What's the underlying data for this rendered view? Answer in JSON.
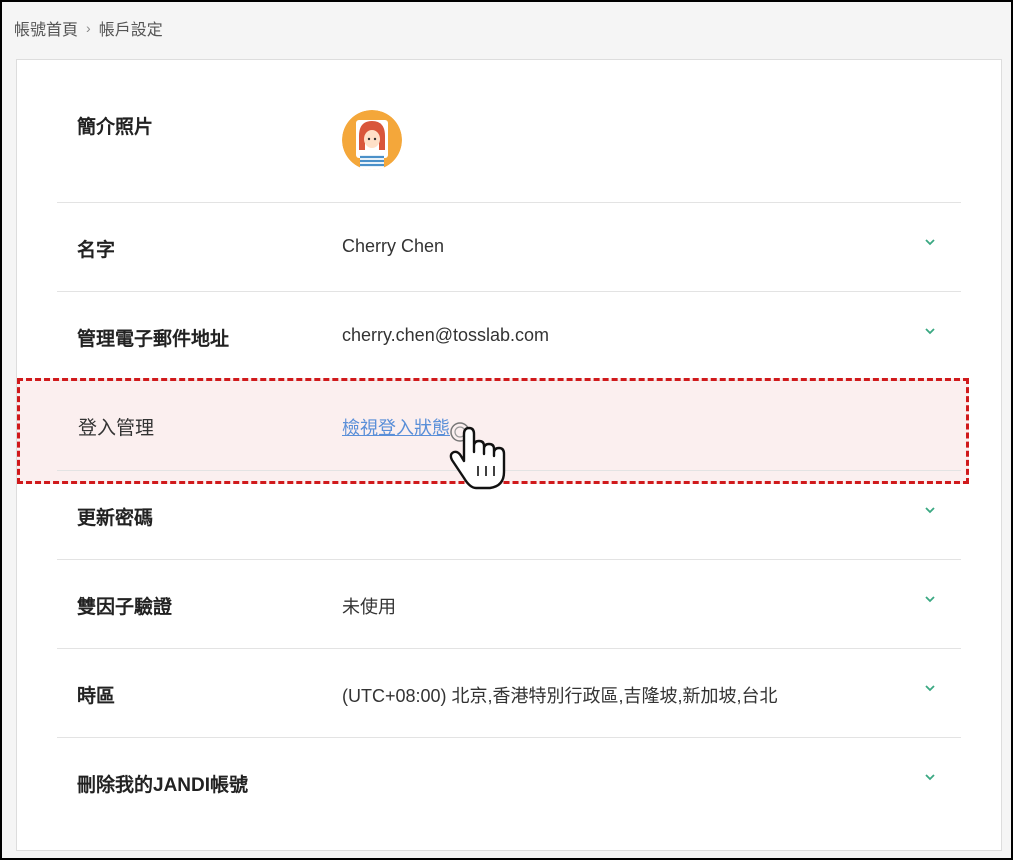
{
  "breadcrumb": {
    "home": "帳號首頁",
    "current": "帳戶設定"
  },
  "settings": {
    "profile_photo": {
      "label": "簡介照片"
    },
    "name": {
      "label": "名字",
      "value": "Cherry Chen"
    },
    "email": {
      "label": "管理電子郵件地址",
      "value": "cherry.chen@tosslab.com"
    },
    "login": {
      "label": "登入管理",
      "link": "檢視登入狀態"
    },
    "password": {
      "label": "更新密碼"
    },
    "two_factor": {
      "label": "雙因子驗證",
      "value": "未使用"
    },
    "timezone": {
      "label": "時區",
      "value": "(UTC+08:00) 北京,香港特別行政區,吉隆坡,新加坡,台北"
    },
    "delete": {
      "label": "刪除我的JANDI帳號"
    }
  },
  "colors": {
    "accent": "#3aa882",
    "link": "#5a8fd8",
    "highlight_border": "#d0191b"
  },
  "icons": [
    "chevron-down-icon",
    "avatar",
    "hand-pointer-icon"
  ]
}
